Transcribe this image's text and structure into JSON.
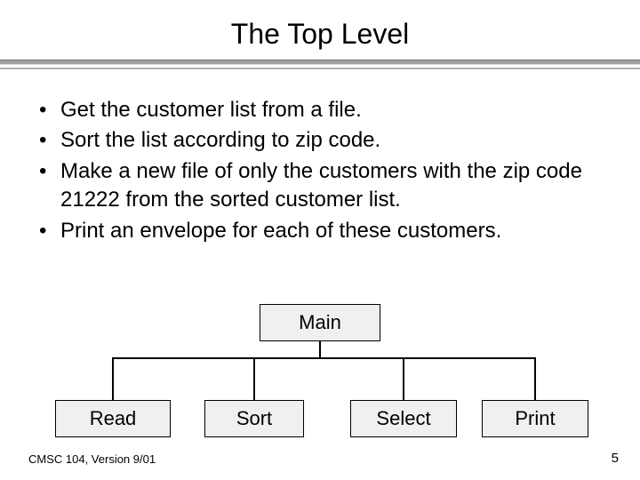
{
  "title": "The Top Level",
  "bullets": [
    "Get the customer list from a file.",
    "Sort the list according to zip code.",
    "Make a new file of only the customers with the zip code 21222 from the sorted customer list.",
    "Print an envelope for each of these customers."
  ],
  "diagram": {
    "root": "Main",
    "children": [
      "Read",
      "Sort",
      "Select",
      "Print"
    ]
  },
  "footer": {
    "course": "CMSC 104, Version 9/01",
    "page": "5"
  }
}
